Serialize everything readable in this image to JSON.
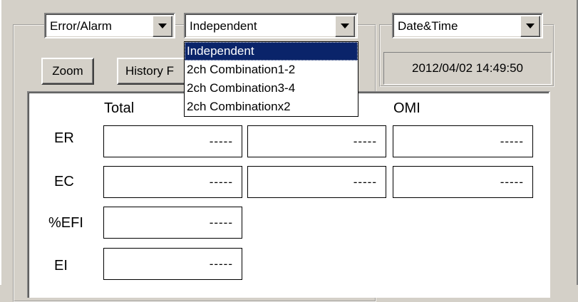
{
  "toolbar": {
    "mode_select": {
      "value": "Error/Alarm"
    },
    "channel_select": {
      "value": "Independent",
      "options": [
        "Independent",
        "2ch Combination1-2",
        "2ch Combination3-4",
        "2ch Combinationx2"
      ],
      "highlighted": "Independent"
    },
    "time_select": {
      "value": "Date&Time"
    },
    "zoom_label": "Zoom",
    "history_label": "History F",
    "datetime_readout": "2012/04/02 14:49:50"
  },
  "panel": {
    "column_headers": [
      "Total",
      "OMI"
    ],
    "rows": [
      {
        "label": "ER",
        "values": [
          "-----",
          "-----",
          "-----"
        ]
      },
      {
        "label": "EC",
        "values": [
          "-----",
          "-----",
          "-----"
        ]
      },
      {
        "label": "%EFI",
        "values": [
          "-----"
        ]
      },
      {
        "label": "EI",
        "values": [
          "-----"
        ]
      }
    ]
  },
  "colors": {
    "face": "#d4d0c8",
    "selection": "#0a246a",
    "panel": "#ffffff"
  }
}
